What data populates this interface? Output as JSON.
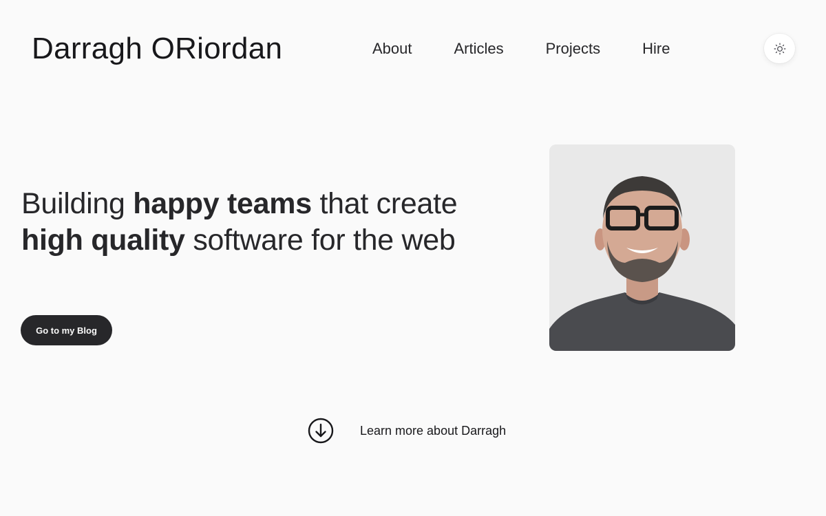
{
  "header": {
    "site_title": "Darragh ORiordan",
    "nav": {
      "about": "About",
      "articles": "Articles",
      "projects": "Projects",
      "hire": "Hire"
    },
    "theme_toggle_icon": "sun-icon"
  },
  "hero": {
    "headline": {
      "part1": "Building ",
      "bold1": "happy teams",
      "part2": " that create ",
      "bold2": "high quality",
      "part3": " software for the web"
    },
    "cta_label": "Go to my Blog",
    "portrait_icon": "portrait-photo"
  },
  "learn_more": {
    "label": "Learn more about Darragh",
    "icon": "arrow-down-circle-icon"
  },
  "colors": {
    "background": "#fafafa",
    "text": "#18181b",
    "button_bg": "#27272a",
    "button_text": "#fafafa"
  }
}
